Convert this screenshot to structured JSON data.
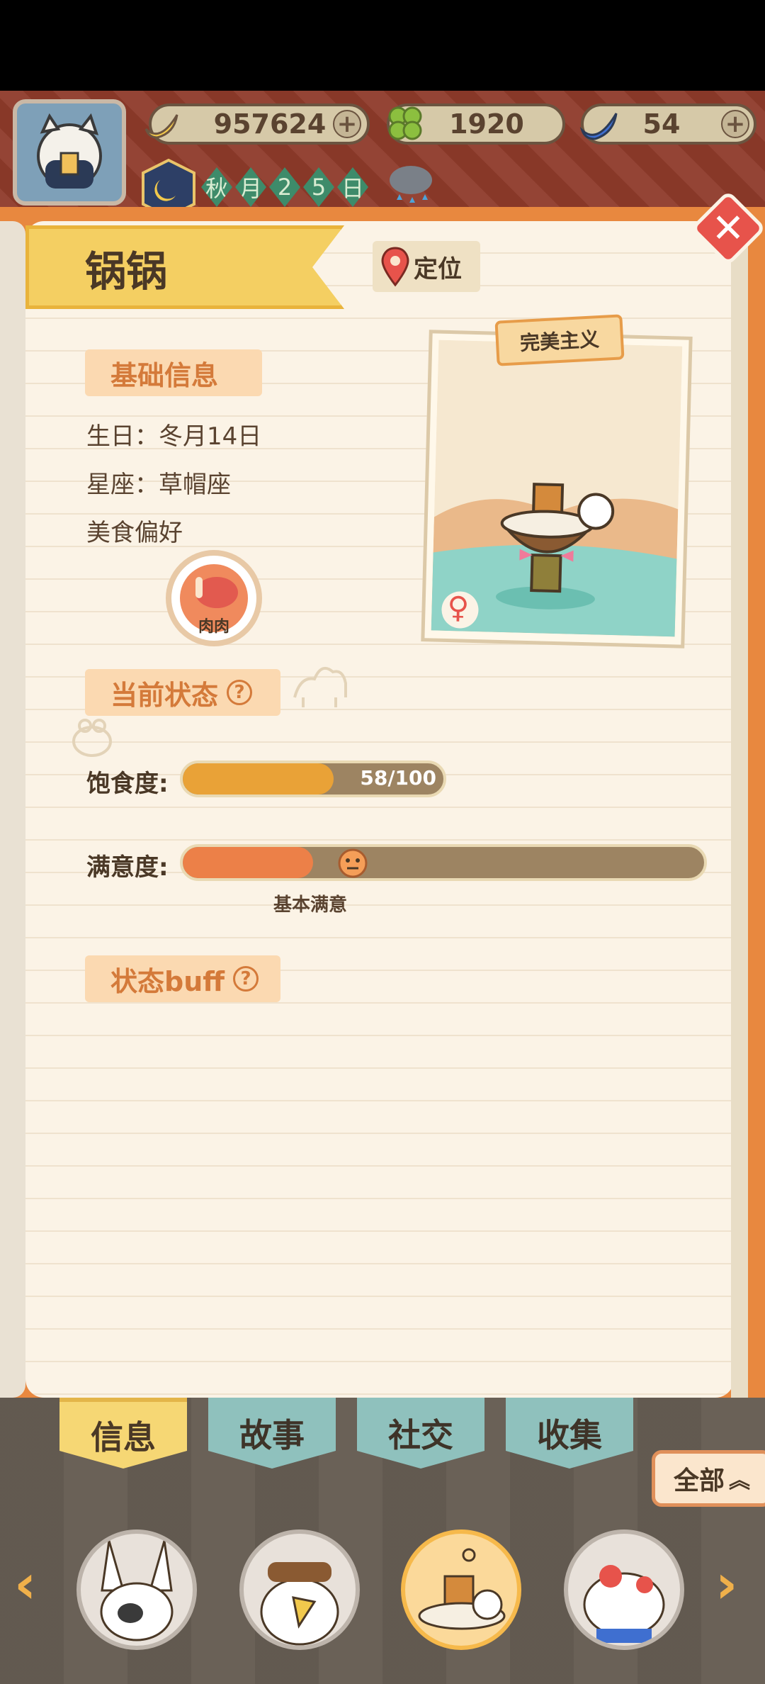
{
  "hud": {
    "bananas": "957624",
    "clovers": "1920",
    "blue_bananas": "54",
    "date_chars": [
      "秋",
      "月",
      "2",
      "5",
      "日"
    ]
  },
  "profile": {
    "name": "锅锅",
    "locate_label": "定位",
    "card_tag": "完美主义",
    "basic_info_title": "基础信息",
    "birthday": "生日：冬月14日",
    "constellation": "星座：草帽座",
    "food_pref_label": "美食偏好",
    "food_item": "肉肉",
    "status_title": "当前状态",
    "satiety_label": "饱食度:",
    "satiety_value": "58/100",
    "satiety_fraction": 0.58,
    "satisfaction_label": "满意度:",
    "satisfaction_text": "基本满意",
    "satisfaction_fraction": 0.25,
    "buff_title": "状态buff"
  },
  "tabs": [
    "信息",
    "故事",
    "社交",
    "收集"
  ],
  "all_label": "全部",
  "colors": {
    "accent_orange": "#e8883f",
    "satiety_fill": "#e9a237",
    "satisfaction_fill": "#ec8048",
    "tab_active": "#f6d774",
    "tab_inactive": "#8fc1bd"
  }
}
